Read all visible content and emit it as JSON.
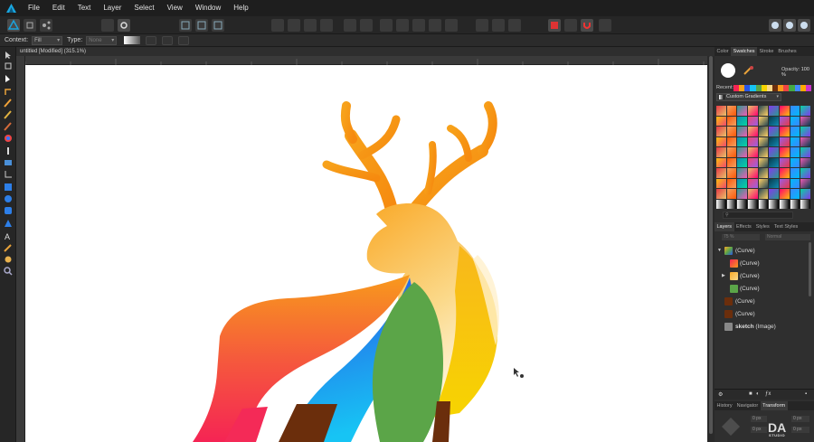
{
  "menubar": {
    "items": [
      "File",
      "Edit",
      "Text",
      "Layer",
      "Select",
      "View",
      "Window",
      "Help"
    ]
  },
  "context": {
    "label": "Context:",
    "fill_value": "Fill",
    "type_label": "Type:",
    "type_value": "None"
  },
  "document": {
    "title": "untitled [Modified] (315.1%)"
  },
  "colour_panel": {
    "tabs": [
      "Color",
      "Swatches",
      "Stroke",
      "Brushes"
    ],
    "active_tab": "Swatches",
    "opacity_label": "Opacity:",
    "opacity_value": "100 %",
    "recent_label": "Recent:",
    "palette_name": "Custom Gradients",
    "search_placeholder": ""
  },
  "layers_panel": {
    "tabs": [
      "Layers",
      "Effects",
      "Styles",
      "Text Styles"
    ],
    "active_tab": "Layers",
    "opacity_value": "75 %",
    "blend_mode": "Normal",
    "layers": [
      {
        "name": "(Curve)",
        "expanded": true
      },
      {
        "name": "(Curve)"
      },
      {
        "name": "(Curve)",
        "collapsed": true
      },
      {
        "name": "(Curve)"
      },
      {
        "name": "(Curve)"
      },
      {
        "name": "(Curve)"
      },
      {
        "name": "sketch",
        "suffix": "(Image)"
      }
    ]
  },
  "bottom_panel": {
    "tabs": [
      "History",
      "Navigator",
      "Transform"
    ],
    "active_tab": "Transform",
    "fields": [
      "0 px",
      "0 px",
      "0 px",
      "0 px"
    ]
  },
  "watermark": {
    "main": "DA",
    "sub": "STUDIO"
  },
  "colors": {
    "accent": "#00a3e0",
    "bg": "#2a2a2a",
    "canvas": "#ffffff"
  }
}
